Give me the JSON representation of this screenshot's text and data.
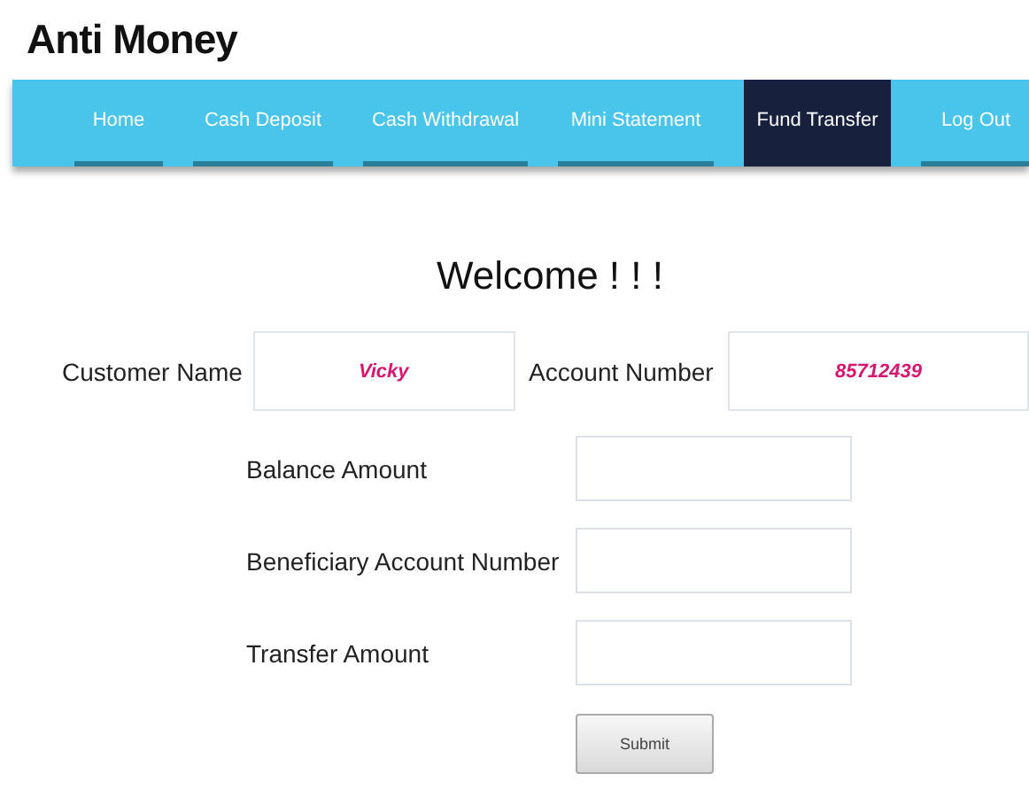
{
  "header": {
    "title": "Anti Money"
  },
  "nav": [
    {
      "label": "Home",
      "selected": false
    },
    {
      "label": "Cash Deposit",
      "selected": false
    },
    {
      "label": "Cash Withdrawal",
      "selected": false
    },
    {
      "label": "Mini Statement",
      "selected": false
    },
    {
      "label": "Fund Transfer",
      "selected": true
    },
    {
      "label": "Log Out",
      "selected": false
    }
  ],
  "heading": "Welcome ! ! !",
  "customer": [
    {
      "label": "Customer Name",
      "value": "Vicky"
    },
    {
      "label": "Account Number",
      "value": "85712439"
    }
  ],
  "fields": [
    {
      "label": "Balance Amount"
    },
    {
      "label": "Beneficiary Account Number"
    },
    {
      "label": "Transfer Amount"
    }
  ],
  "submit": "Submit"
}
